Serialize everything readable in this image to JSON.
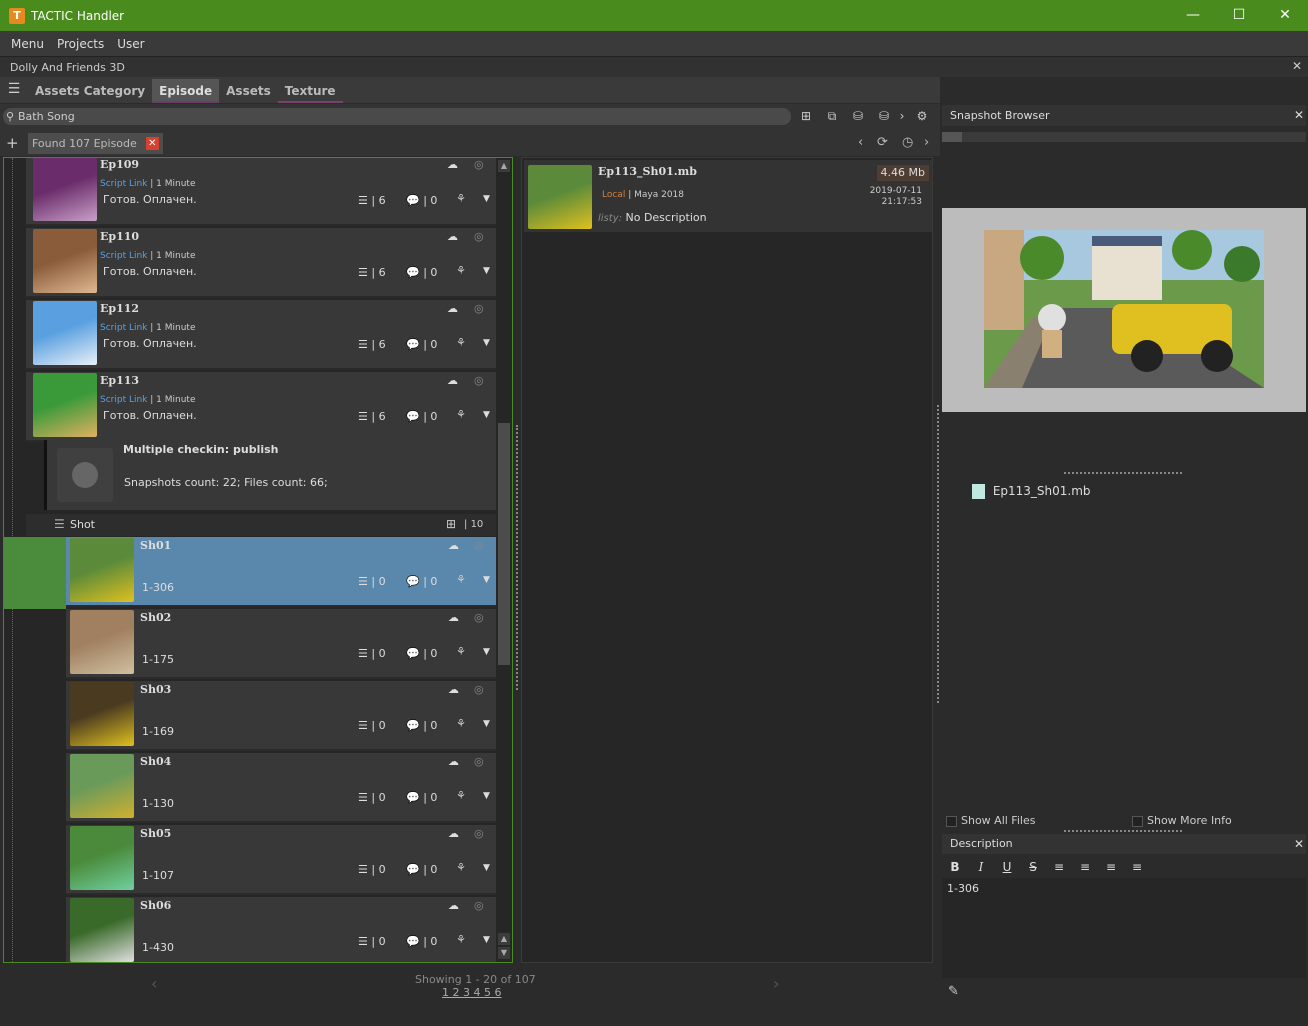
{
  "window": {
    "title": "TACTIC Handler",
    "minimize": "—",
    "maximize": "☐",
    "close": "✕"
  },
  "menu": [
    "Menu",
    "Projects",
    "User"
  ],
  "project": {
    "name": "Dolly And Friends 3D",
    "close": "✕"
  },
  "tabs": [
    {
      "label": "Assets Category"
    },
    {
      "label": "Episode"
    },
    {
      "label": "Assets"
    },
    {
      "label": "Texture"
    }
  ],
  "search": {
    "value": "Bath Song"
  },
  "found": {
    "label": "Found 107 Episode",
    "close": "✕"
  },
  "episodes": [
    {
      "name": "Ep109",
      "link": "Script Link",
      "duration": "1 Minute",
      "status": "Готов. Оплачен.",
      "tasks": "6",
      "notes": "0",
      "colors": [
        "#6a2c6a",
        "#c8a0c8"
      ]
    },
    {
      "name": "Ep110",
      "link": "Script Link",
      "duration": "1 Minute",
      "status": "Готов. Оплачен.",
      "tasks": "6",
      "notes": "0",
      "colors": [
        "#8a5c3a",
        "#e0b890"
      ]
    },
    {
      "name": "Ep112",
      "link": "Script Link",
      "duration": "1 Minute",
      "status": "Готов. Оплачен.",
      "tasks": "6",
      "notes": "0",
      "colors": [
        "#5aa0e0",
        "#e8f0f8"
      ]
    },
    {
      "name": "Ep113",
      "link": "Script Link",
      "duration": "1 Minute",
      "status": "Готов. Оплачен.",
      "tasks": "6",
      "notes": "0",
      "colors": [
        "#3a9a3a",
        "#e0b060"
      ]
    }
  ],
  "checkin": {
    "title": "Multiple checkin: publish",
    "info": "Snapshots count: 22; Files count: 66;"
  },
  "shot_group": {
    "label": "Shot",
    "count": "10"
  },
  "shots": [
    {
      "name": "Sh01",
      "range": "1-306",
      "tasks": "0",
      "notes": "0",
      "colors": [
        "#5a8a3a",
        "#e0c020"
      ]
    },
    {
      "name": "Sh02",
      "range": "1-175",
      "tasks": "0",
      "notes": "0",
      "colors": [
        "#a08060",
        "#d0c0a0"
      ]
    },
    {
      "name": "Sh03",
      "range": "1-169",
      "tasks": "0",
      "notes": "0",
      "colors": [
        "#4a3a20",
        "#e0c020"
      ]
    },
    {
      "name": "Sh04",
      "range": "1-130",
      "tasks": "0",
      "notes": "0",
      "colors": [
        "#6a9a5a",
        "#d0b030"
      ]
    },
    {
      "name": "Sh05",
      "range": "1-107",
      "tasks": "0",
      "notes": "0",
      "colors": [
        "#4a8a3a",
        "#70d0a0"
      ]
    },
    {
      "name": "Sh06",
      "range": "1-430",
      "tasks": "0",
      "notes": "0",
      "colors": [
        "#3a6a2a",
        "#e0e0e0"
      ]
    }
  ],
  "pager": {
    "text": "Showing 1 - 20 of 107",
    "pages": "1 2 3 4 5 6"
  },
  "snapshot": {
    "name": "Ep113_Sh01.mb",
    "size": "4.46 Mb",
    "date": "2019-07-11",
    "time": "21:17:53",
    "location": "Local",
    "app": "Maya 2018",
    "user": "listy:",
    "description": "No Description"
  },
  "snapshot_browser": {
    "title": "Snapshot Browser",
    "file": "Ep113_Sh01.mb",
    "show_all": "Show All Files",
    "show_more": "Show More Info"
  },
  "description_panel": {
    "title": "Description",
    "text": "1-306",
    "format": [
      "B",
      "I",
      "U",
      "S",
      "≡",
      "≡",
      "≡",
      "≡"
    ]
  },
  "icons": {
    "tasks": "tasks-icon",
    "notes": "notes-icon",
    "cloud": "cloud-icon",
    "eye": "eye-icon",
    "tree": "hierarchy-icon"
  }
}
